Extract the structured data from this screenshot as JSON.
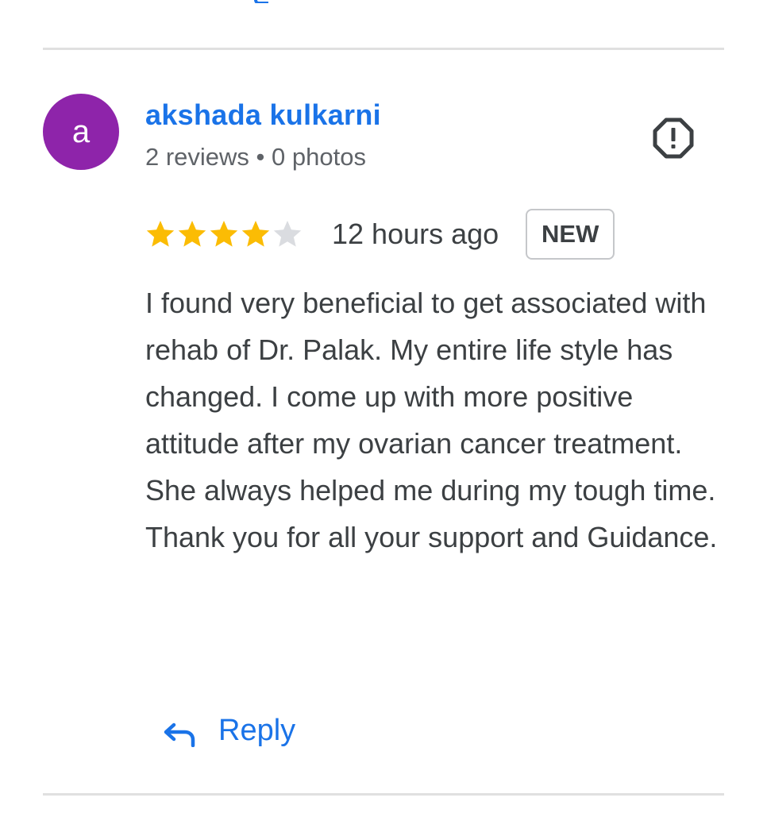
{
  "colors": {
    "link_blue": "#1a73e8",
    "avatar_purple": "#8e24aa",
    "star_filled": "#fbbc04",
    "star_empty": "#dadce0",
    "divider": "#e0e0e0"
  },
  "review": {
    "avatar_letter": "a",
    "reviewer_name": "akshada kulkarni",
    "reviewer_meta": "2 reviews • 0 photos",
    "rating": 4,
    "rating_max": 5,
    "time_ago": "12 hours ago",
    "badge": "NEW",
    "text": "I found very beneficial to get associated with rehab of Dr. Palak. My entire life style has changed. I come up with more positive attitude after my ovarian cancer treatment. She always helped me during my tough time. Thank you for all your support and Guidance.",
    "report_icon": "report-icon",
    "reply_icon": "reply-arrow-icon",
    "reply_label": "Reply"
  }
}
